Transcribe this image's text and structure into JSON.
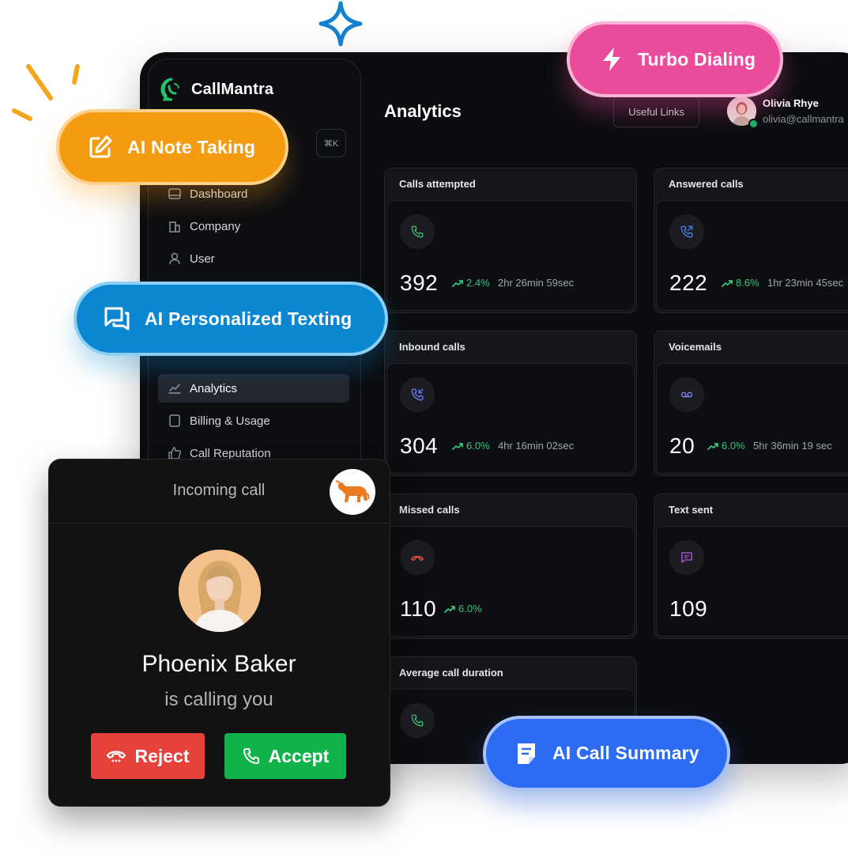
{
  "app": {
    "name": "CallMantra",
    "shortcut": "⌘K"
  },
  "sidebar": {
    "items": [
      {
        "label": "Dashboard",
        "icon": "dashboard-icon",
        "active": false
      },
      {
        "label": "Company",
        "icon": "building-icon",
        "active": false
      },
      {
        "label": "User",
        "icon": "user-icon",
        "active": false
      },
      {
        "label": "Analytics",
        "icon": "chart-line-icon",
        "active": true
      },
      {
        "label": "Billing & Usage",
        "icon": "tablet-icon",
        "active": false
      },
      {
        "label": "Call Reputation",
        "icon": "thumbs-up-icon",
        "active": false
      }
    ]
  },
  "header": {
    "title": "Analytics",
    "useful_links": "Useful Links",
    "user": {
      "name": "Olivia Rhye",
      "email": "olivia@callmantra"
    }
  },
  "cards": [
    {
      "title": "Calls attempted",
      "icon": "phone-icon",
      "icon_color": "#3bbf72",
      "value": "392",
      "trend": "2.4%",
      "duration": "2hr 26min 59sec"
    },
    {
      "title": "Answered calls",
      "icon": "phone-incoming-icon",
      "icon_color": "#4c7cf0",
      "value": "222",
      "trend": "8.6%",
      "duration": "1hr 23min 45sec"
    },
    {
      "title": "Inbound calls",
      "icon": "phone-inbound-icon",
      "icon_color": "#6d7cf5",
      "value": "304",
      "trend": "6.0%",
      "duration": "4hr 16min 02sec"
    },
    {
      "title": "Voicemails",
      "icon": "voicemail-icon",
      "icon_color": "#8a8ff7",
      "value": "20",
      "trend": "6.0%",
      "duration": "5hr 36min 19 sec"
    },
    {
      "title": "Missed calls",
      "icon": "phone-missed-icon",
      "icon_color": "#e5533d",
      "value": "110",
      "trend": "6.0%",
      "duration": ""
    },
    {
      "title": "Text sent",
      "icon": "message-icon",
      "icon_color": "#b45be6",
      "value": "109",
      "trend": "",
      "duration": ""
    },
    {
      "title": "Average call duration",
      "icon": "phone-icon",
      "icon_color": "#3bbf72",
      "value": "",
      "trend": "",
      "duration": ""
    }
  ],
  "features": {
    "note_taking": "AI Note Taking",
    "personalized_texting": "AI Personalized Texting",
    "turbo_dialing": "Turbo Dialing",
    "call_summary": "AI Call Summary"
  },
  "incoming_call": {
    "header": "Incoming call",
    "caller_name": "Phoenix Baker",
    "subtitle": "is calling you",
    "reject_label": "Reject",
    "accept_label": "Accept"
  },
  "colors": {
    "note": "#f49b12",
    "texting": "#0b87d2",
    "turbo": "#ea4b9a",
    "summary": "#2b6cf2",
    "reject": "#e6413a",
    "accept": "#10b24a",
    "trend": "#39c27a"
  }
}
